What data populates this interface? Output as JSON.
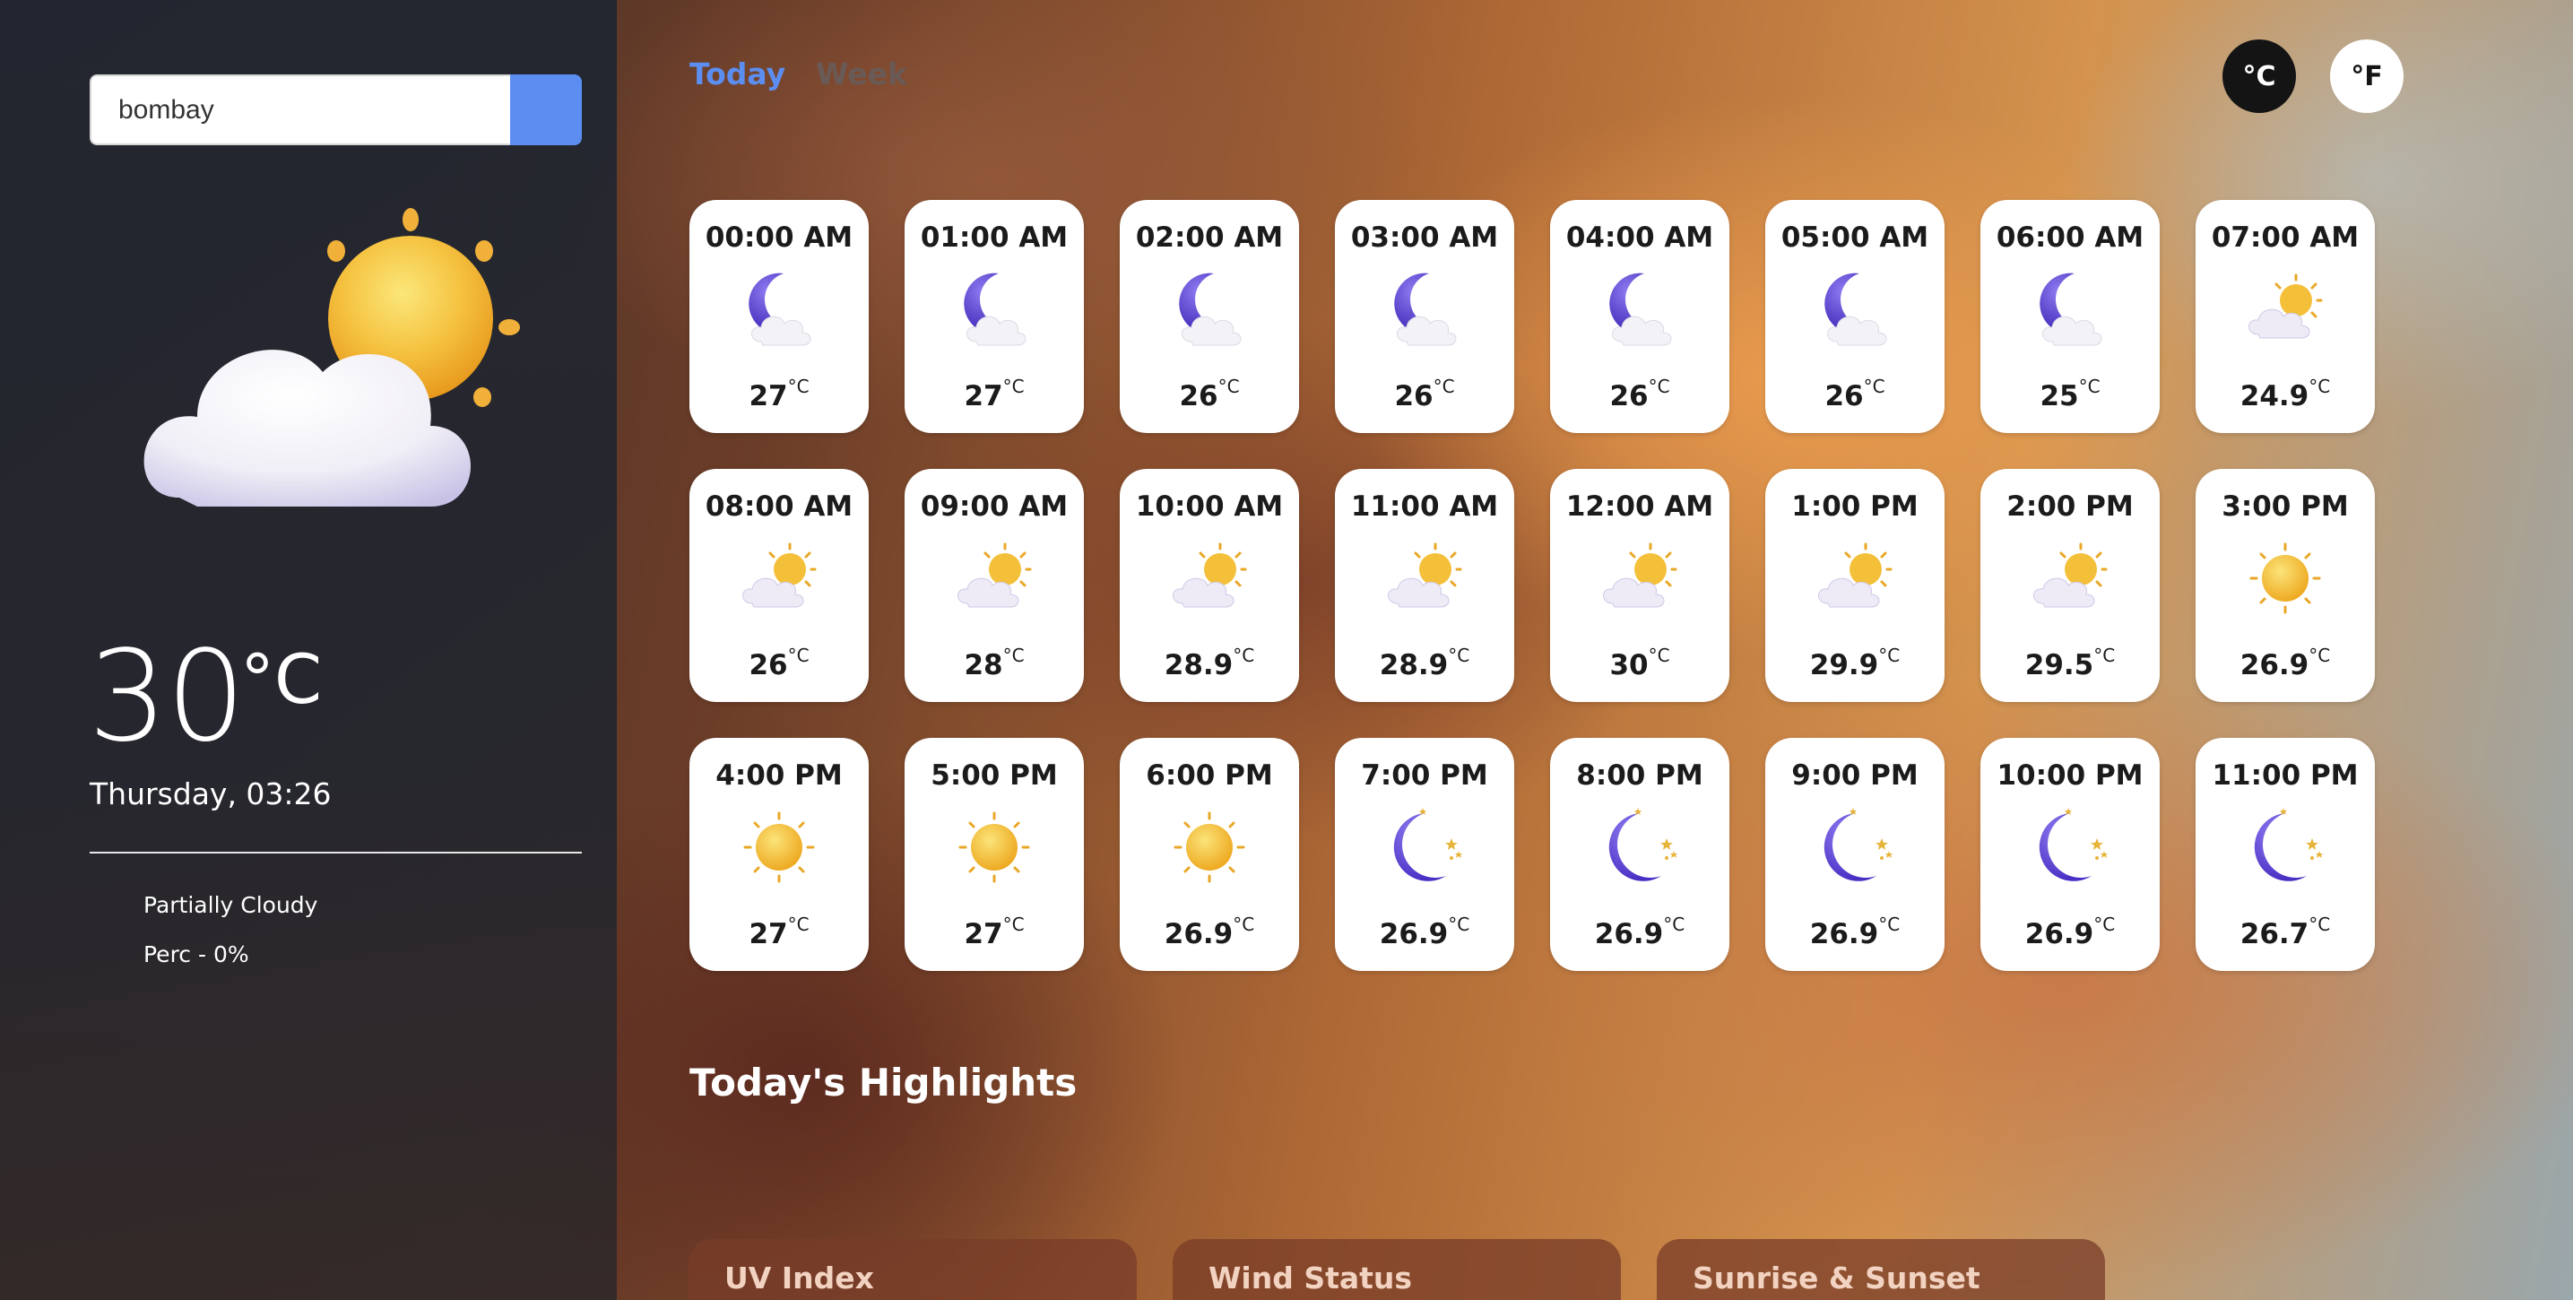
{
  "search": {
    "value": "bombay"
  },
  "current": {
    "temp": "30",
    "unit": "°C",
    "datetime": "Thursday, 03:26",
    "condition": "Partially Cloudy",
    "precip": "Perc - 0%"
  },
  "tabs": [
    {
      "label": "Today"
    },
    {
      "label": "Week"
    }
  ],
  "units": {
    "c": "°C",
    "f": "°F"
  },
  "hourly": [
    {
      "time": "00:00 AM",
      "temp": "27",
      "icon": "moon-cloud-icon"
    },
    {
      "time": "01:00 AM",
      "temp": "27",
      "icon": "moon-cloud-icon"
    },
    {
      "time": "02:00 AM",
      "temp": "26",
      "icon": "moon-cloud-icon"
    },
    {
      "time": "03:00 AM",
      "temp": "26",
      "icon": "moon-cloud-icon"
    },
    {
      "time": "04:00 AM",
      "temp": "26",
      "icon": "moon-cloud-icon"
    },
    {
      "time": "05:00 AM",
      "temp": "26",
      "icon": "moon-cloud-icon"
    },
    {
      "time": "06:00 AM",
      "temp": "25",
      "icon": "moon-cloud-icon"
    },
    {
      "time": "07:00 AM",
      "temp": "24.9",
      "icon": "sun-cloud-icon"
    },
    {
      "time": "08:00 AM",
      "temp": "26",
      "icon": "sun-cloud-icon"
    },
    {
      "time": "09:00 AM",
      "temp": "28",
      "icon": "sun-cloud-icon"
    },
    {
      "time": "10:00 AM",
      "temp": "28.9",
      "icon": "sun-cloud-icon"
    },
    {
      "time": "11:00 AM",
      "temp": "28.9",
      "icon": "sun-cloud-icon"
    },
    {
      "time": "12:00 AM",
      "temp": "30",
      "icon": "sun-cloud-icon"
    },
    {
      "time": "1:00 PM",
      "temp": "29.9",
      "icon": "sun-cloud-icon"
    },
    {
      "time": "2:00 PM",
      "temp": "29.5",
      "icon": "sun-cloud-icon"
    },
    {
      "time": "3:00 PM",
      "temp": "26.9",
      "icon": "sun-icon"
    },
    {
      "time": "4:00 PM",
      "temp": "27",
      "icon": "sun-icon"
    },
    {
      "time": "5:00 PM",
      "temp": "27",
      "icon": "sun-icon"
    },
    {
      "time": "6:00 PM",
      "temp": "26.9",
      "icon": "sun-icon"
    },
    {
      "time": "7:00 PM",
      "temp": "26.9",
      "icon": "moon-stars-icon"
    },
    {
      "time": "8:00 PM",
      "temp": "26.9",
      "icon": "moon-stars-icon"
    },
    {
      "time": "9:00 PM",
      "temp": "26.9",
      "icon": "moon-stars-icon"
    },
    {
      "time": "10:00 PM",
      "temp": "26.9",
      "icon": "moon-stars-icon"
    },
    {
      "time": "11:00 PM",
      "temp": "26.7",
      "icon": "moon-stars-icon"
    }
  ],
  "hourly_unit": "°C",
  "highlights": {
    "title": "Today's Highlights",
    "cards": [
      {
        "label": "UV Index"
      },
      {
        "label": "Wind Status"
      },
      {
        "label": "Sunrise & Sunset"
      }
    ]
  },
  "colors": {
    "accent": "#5b8ef0",
    "moon": "#5a3fd0",
    "sun": "#f3b630"
  }
}
